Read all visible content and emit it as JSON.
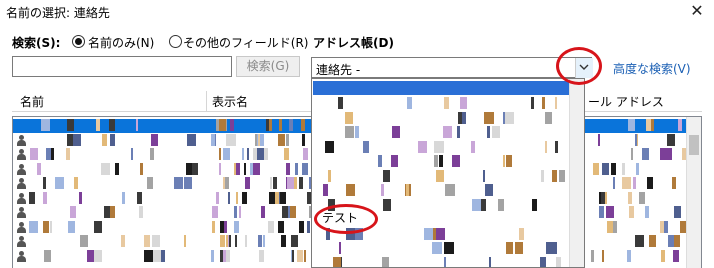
{
  "window": {
    "title": "名前の選択: 連絡先",
    "close_glyph": "✕"
  },
  "search": {
    "label": "検索(S):",
    "option_name_only": "名前のみ(N)",
    "option_other_fields": "その他のフィールド(R)",
    "input_value": "",
    "search_button": "検索(G)"
  },
  "address_book": {
    "label": "アドレス帳(D)",
    "selected": "連絡先 -",
    "advanced_search_link": "高度な検索(V)",
    "arrow_glyph": "⌄"
  },
  "columns": {
    "name": "名前",
    "display_name": "表示名",
    "email": "ール アドレス"
  },
  "dropdown": {
    "visible_item": "テスト"
  },
  "colors": {
    "selection": "#0a74da",
    "link": "#1a5fb4",
    "annotation": "#d7141a"
  },
  "icons": [
    "close-icon",
    "radio-icon",
    "dropdown-arrow-icon",
    "person-icon",
    "scrollbar"
  ]
}
